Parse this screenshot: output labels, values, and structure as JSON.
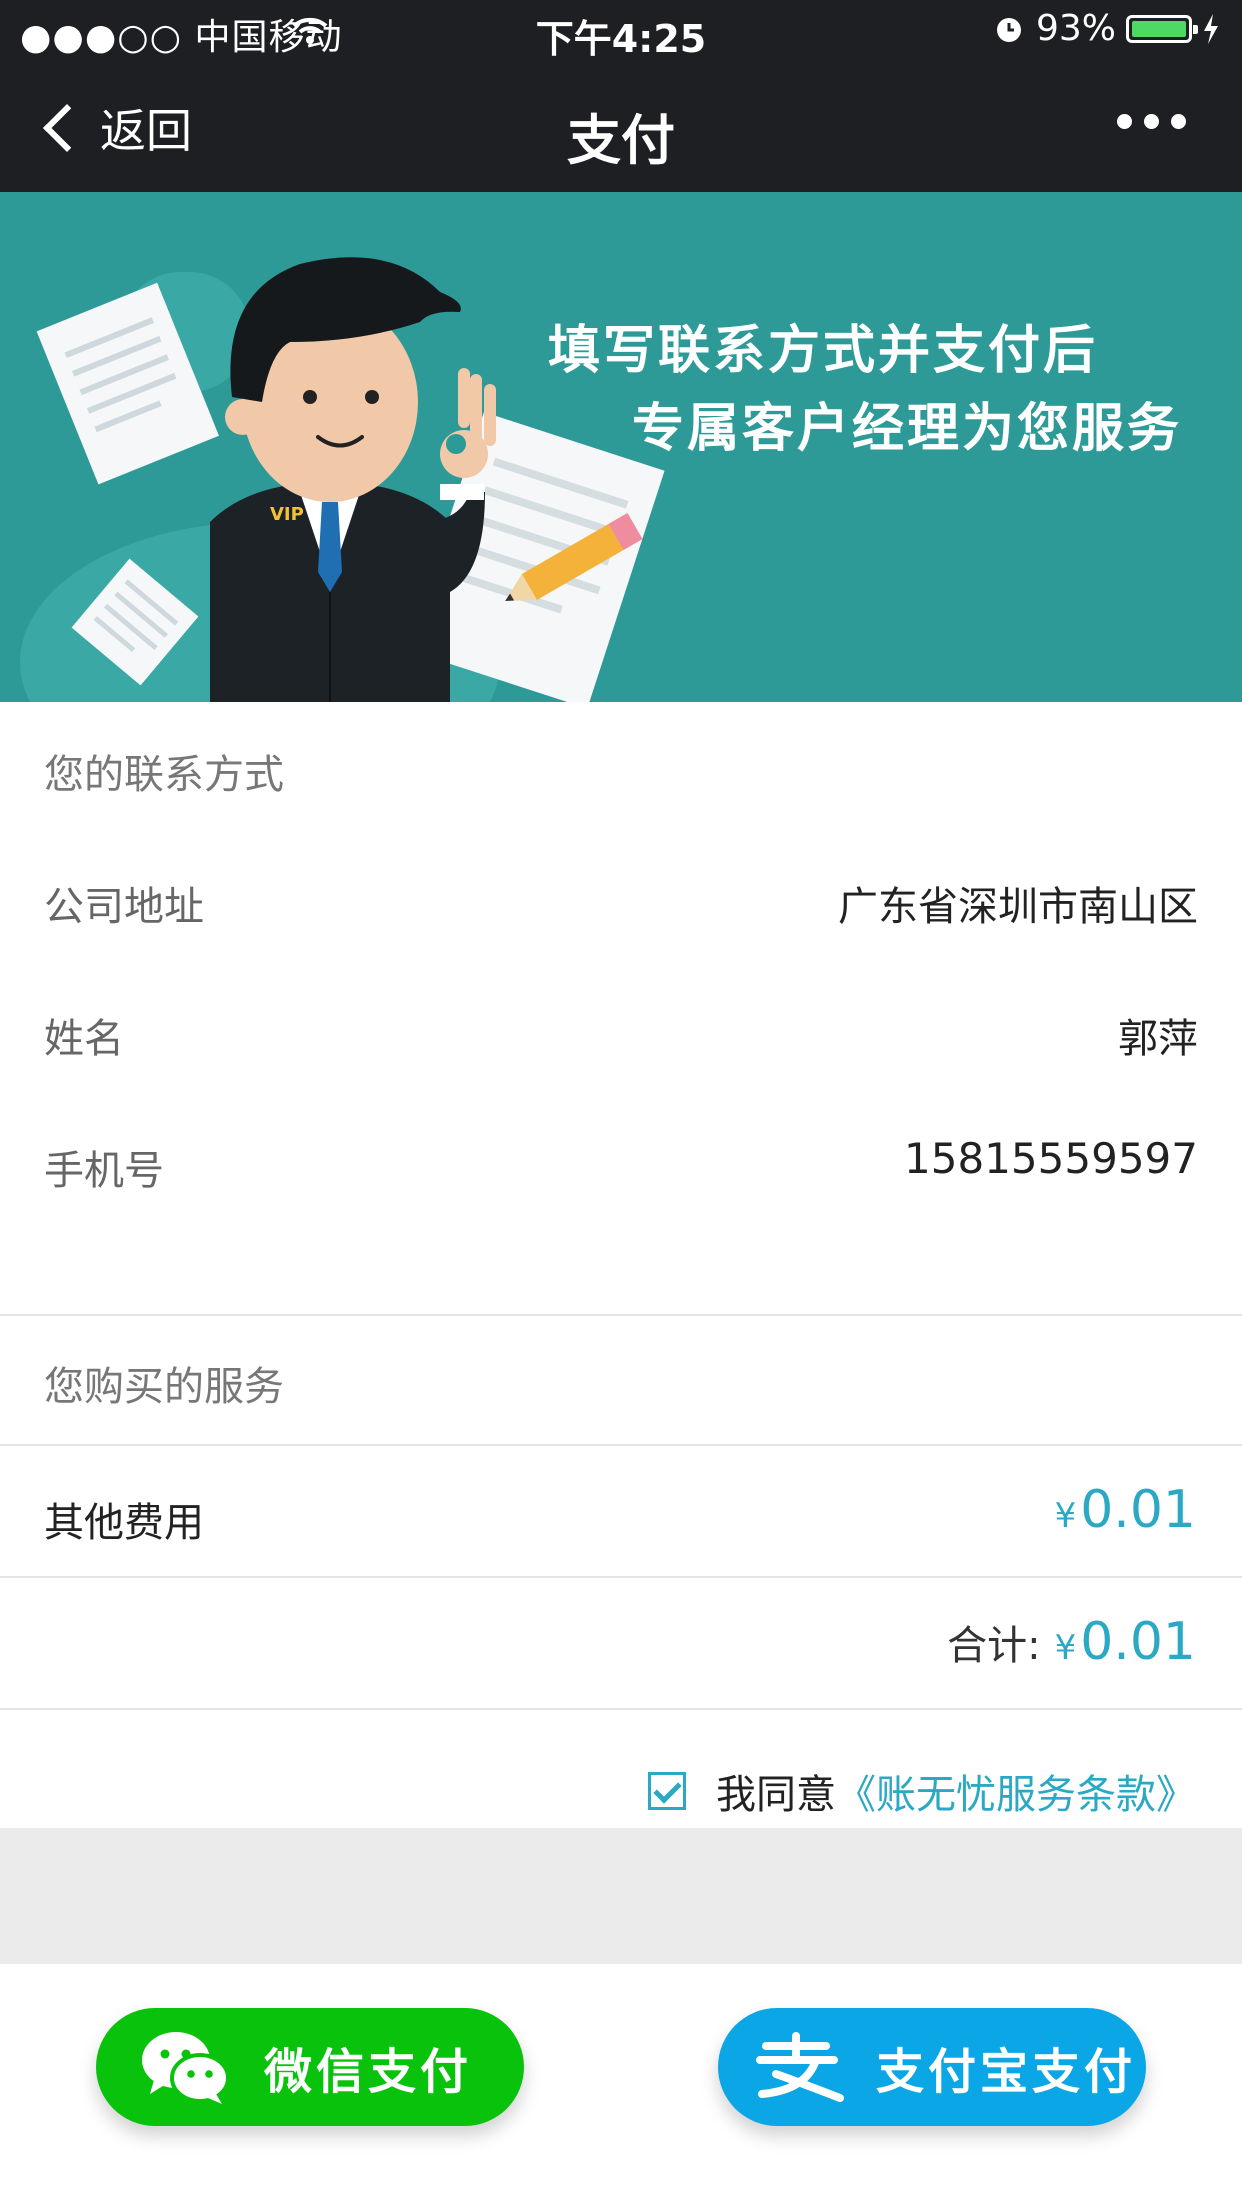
{
  "status": {
    "carrier": "●●●○○ 中国移动",
    "time": "下午4:25",
    "battery": "93%",
    "battery_level": 0.93
  },
  "nav": {
    "back_label": "返回",
    "title": "支付"
  },
  "banner": {
    "line1": "填写联系方式并支付后",
    "line2": "专属客户经理为您服务",
    "badge": "VIP"
  },
  "contact": {
    "section_title": "您的联系方式",
    "rows": [
      {
        "label": "公司地址",
        "value": "广东省深圳市南山区"
      },
      {
        "label": "姓名",
        "value": "郭萍"
      },
      {
        "label": "手机号",
        "value": "15815559597"
      }
    ]
  },
  "service": {
    "section_title": "您购买的服务",
    "item_label": "其他费用",
    "currency": "¥",
    "item_price": "0.01",
    "total_label": "合计:",
    "total_price": "0.01"
  },
  "agreement": {
    "checked": true,
    "text": "我同意",
    "link": "《账无忧服务条款》"
  },
  "buttons": {
    "wechat_label": "微信支付",
    "alipay_label": "支付宝支付"
  },
  "colors": {
    "accent": "#2aa8c4",
    "banner": "#2d9a97",
    "wechat": "#09c20c",
    "alipay": "#0aa6e6",
    "topbar": "#1e1f22"
  }
}
